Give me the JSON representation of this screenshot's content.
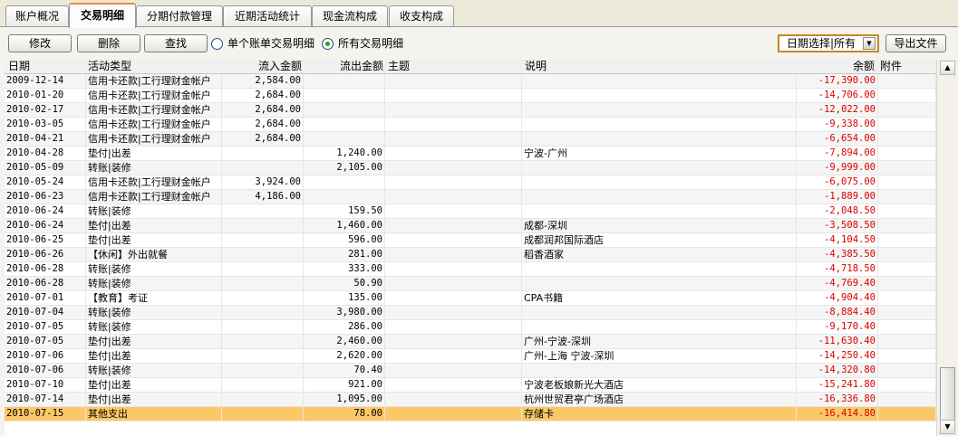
{
  "tabs": [
    {
      "label": "账户概况"
    },
    {
      "label": "交易明细"
    },
    {
      "label": "分期付款管理"
    },
    {
      "label": "近期活动统计"
    },
    {
      "label": "现金流构成"
    },
    {
      "label": "收支构成"
    }
  ],
  "toolbar": {
    "edit_label": "修改",
    "delete_label": "删除",
    "find_label": "查找",
    "radio_single": "单个账单交易明细",
    "radio_all": "所有交易明细",
    "date_select": "日期选择|所有",
    "export_label": "导出文件"
  },
  "table": {
    "columns": {
      "date": "日期",
      "type": "活动类型",
      "inflow": "流入金额",
      "outflow": "流出金额",
      "subject": "主题",
      "desc": "说明",
      "balance": "余额",
      "attach": "附件"
    },
    "rows": [
      {
        "date": "2009-12-14",
        "type": "信用卡还款|工行理财金帐户",
        "in": "2,584.00",
        "out": "",
        "subj": "",
        "desc": "",
        "bal": "-17,390.00"
      },
      {
        "date": "2010-01-20",
        "type": "信用卡还款|工行理财金帐户",
        "in": "2,684.00",
        "out": "",
        "subj": "",
        "desc": "",
        "bal": "-14,706.00"
      },
      {
        "date": "2010-02-17",
        "type": "信用卡还款|工行理财金帐户",
        "in": "2,684.00",
        "out": "",
        "subj": "",
        "desc": "",
        "bal": "-12,022.00"
      },
      {
        "date": "2010-03-05",
        "type": "信用卡还款|工行理财金帐户",
        "in": "2,684.00",
        "out": "",
        "subj": "",
        "desc": "",
        "bal": "-9,338.00"
      },
      {
        "date": "2010-04-21",
        "type": "信用卡还款|工行理财金帐户",
        "in": "2,684.00",
        "out": "",
        "subj": "",
        "desc": "",
        "bal": "-6,654.00"
      },
      {
        "date": "2010-04-28",
        "type": "垫付|出差",
        "in": "",
        "out": "1,240.00",
        "subj": "",
        "desc": "宁波-广州",
        "bal": "-7,894.00"
      },
      {
        "date": "2010-05-09",
        "type": "转账|装修",
        "in": "",
        "out": "2,105.00",
        "subj": "",
        "desc": "",
        "bal": "-9,999.00"
      },
      {
        "date": "2010-05-24",
        "type": "信用卡还款|工行理财金帐户",
        "in": "3,924.00",
        "out": "",
        "subj": "",
        "desc": "",
        "bal": "-6,075.00"
      },
      {
        "date": "2010-06-23",
        "type": "信用卡还款|工行理财金帐户",
        "in": "4,186.00",
        "out": "",
        "subj": "",
        "desc": "",
        "bal": "-1,889.00"
      },
      {
        "date": "2010-06-24",
        "type": "转账|装修",
        "in": "",
        "out": "159.50",
        "subj": "",
        "desc": "",
        "bal": "-2,048.50"
      },
      {
        "date": "2010-06-24",
        "type": "垫付|出差",
        "in": "",
        "out": "1,460.00",
        "subj": "",
        "desc": "成都-深圳",
        "bal": "-3,508.50"
      },
      {
        "date": "2010-06-25",
        "type": "垫付|出差",
        "in": "",
        "out": "596.00",
        "subj": "",
        "desc": "成都润邦国际酒店",
        "bal": "-4,104.50"
      },
      {
        "date": "2010-06-26",
        "type": "【休闲】外出就餐",
        "in": "",
        "out": "281.00",
        "subj": "",
        "desc": "稻香酒家",
        "bal": "-4,385.50"
      },
      {
        "date": "2010-06-28",
        "type": "转账|装修",
        "in": "",
        "out": "333.00",
        "subj": "",
        "desc": "",
        "bal": "-4,718.50"
      },
      {
        "date": "2010-06-28",
        "type": "转账|装修",
        "in": "",
        "out": "50.90",
        "subj": "",
        "desc": "",
        "bal": "-4,769.40"
      },
      {
        "date": "2010-07-01",
        "type": "【教育】考证",
        "in": "",
        "out": "135.00",
        "subj": "",
        "desc": "CPA书籍",
        "bal": "-4,904.40"
      },
      {
        "date": "2010-07-04",
        "type": "转账|装修",
        "in": "",
        "out": "3,980.00",
        "subj": "",
        "desc": "",
        "bal": "-8,884.40"
      },
      {
        "date": "2010-07-05",
        "type": "转账|装修",
        "in": "",
        "out": "286.00",
        "subj": "",
        "desc": "",
        "bal": "-9,170.40"
      },
      {
        "date": "2010-07-05",
        "type": "垫付|出差",
        "in": "",
        "out": "2,460.00",
        "subj": "",
        "desc": "广州-宁波-深圳",
        "bal": "-11,630.40"
      },
      {
        "date": "2010-07-06",
        "type": "垫付|出差",
        "in": "",
        "out": "2,620.00",
        "subj": "",
        "desc": "广州-上海 宁波-深圳",
        "bal": "-14,250.40"
      },
      {
        "date": "2010-07-06",
        "type": "转账|装修",
        "in": "",
        "out": "70.40",
        "subj": "",
        "desc": "",
        "bal": "-14,320.80"
      },
      {
        "date": "2010-07-10",
        "type": "垫付|出差",
        "in": "",
        "out": "921.00",
        "subj": "",
        "desc": "宁波老板娘新光大酒店",
        "bal": "-15,241.80"
      },
      {
        "date": "2010-07-14",
        "type": "垫付|出差",
        "in": "",
        "out": "1,095.00",
        "subj": "",
        "desc": "杭州世贸君亭广场酒店",
        "bal": "-16,336.80"
      },
      {
        "date": "2010-07-15",
        "type": "其他支出",
        "in": "",
        "out": "78.00",
        "subj": "",
        "desc": "存储卡",
        "bal": "-16,414.80"
      }
    ]
  },
  "colors": {
    "selected_row": "#fcc866",
    "negative": "#d80000",
    "tab_accent": "#e68b2c"
  }
}
